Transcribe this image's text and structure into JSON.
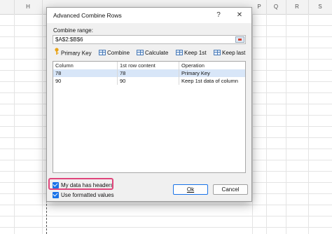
{
  "spreadsheet": {
    "columns": [
      "H",
      "",
      "",
      "",
      "",
      "",
      "",
      "",
      "P",
      "Q",
      "R",
      "S"
    ]
  },
  "dialog": {
    "title": "Advanced Combine Rows",
    "help_label": "?",
    "close_label": "✕",
    "combine_range_label": "Combine range:",
    "combine_range_value": "$A$2:$B$6",
    "toolbar": {
      "primary_key": "Primary Key",
      "combine": "Combine",
      "calculate": "Calculate",
      "keep_first": "Keep 1st",
      "keep_last": "Keep last"
    },
    "table": {
      "headers": [
        "Column",
        "1st row content",
        "Operation"
      ],
      "rows": [
        [
          "78",
          "78",
          "Primary Key"
        ],
        [
          "90",
          "90",
          "Keep 1st data of column"
        ]
      ],
      "selected_row": 0
    },
    "my_data_has_headers": {
      "label": "My data has headers",
      "checked": true
    },
    "use_formatted_values": {
      "label": "Use formatted values",
      "checked": true
    },
    "ok_button": "Ok",
    "cancel_button": "Cancel"
  }
}
